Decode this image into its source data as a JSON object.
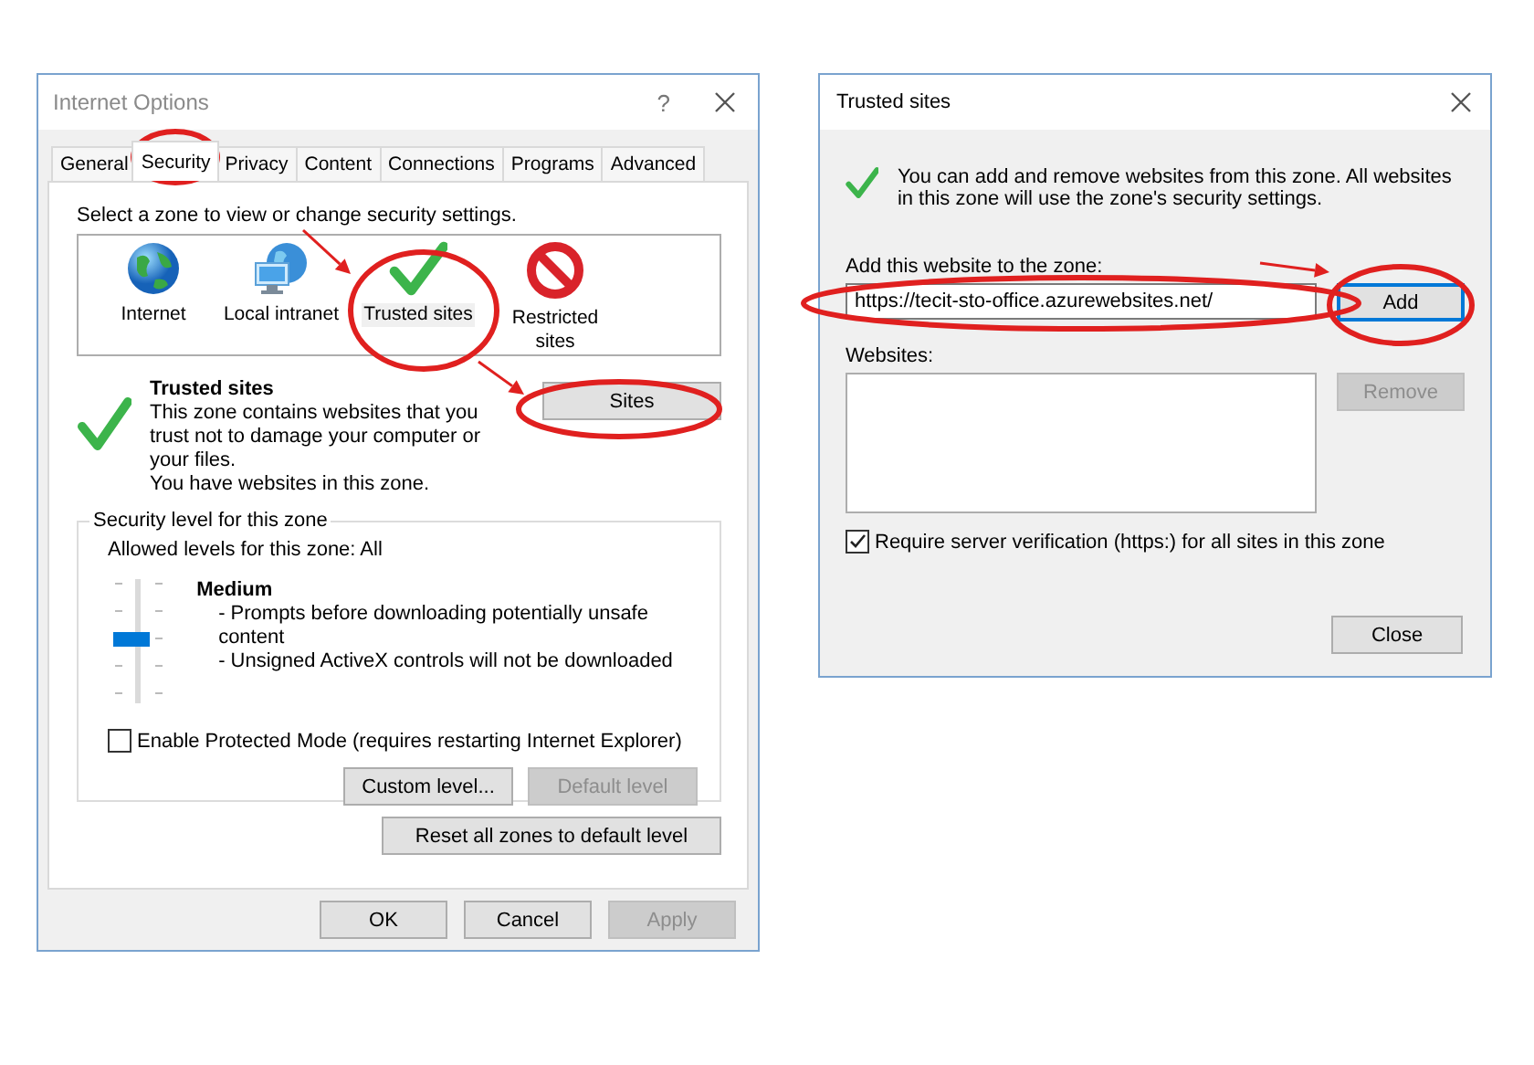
{
  "internet_options": {
    "title": "Internet Options",
    "help": "?",
    "tabs": [
      {
        "label": "General",
        "selected": false
      },
      {
        "label": "Security",
        "selected": true
      },
      {
        "label": "Privacy",
        "selected": false
      },
      {
        "label": "Content",
        "selected": false
      },
      {
        "label": "Connections",
        "selected": false
      },
      {
        "label": "Programs",
        "selected": false
      },
      {
        "label": "Advanced",
        "selected": false
      }
    ],
    "zone_prompt": "Select a zone to view or change security settings.",
    "zones": [
      {
        "label": "Internet",
        "kind": "globe",
        "selected": false
      },
      {
        "label": "Local intranet",
        "kind": "intranet",
        "selected": false
      },
      {
        "label": "Trusted sites",
        "kind": "trusted",
        "selected": true
      },
      {
        "label": "Restricted sites",
        "kind": "restricted",
        "selected": false
      }
    ],
    "zone_info": {
      "title": "Trusted sites",
      "description": "This zone contains websites that you trust not to damage your computer or your files.",
      "note": "You have websites in this zone."
    },
    "sites_button": "Sites",
    "security_level": {
      "legend": "Security level for this zone",
      "allowed": "Allowed levels for this zone: All",
      "level": 0.5,
      "name": "Medium",
      "bullets": [
        "- Prompts before downloading potentially unsafe content",
        "- Unsigned ActiveX controls will not be downloaded"
      ]
    },
    "protected_mode": {
      "label": "Enable Protected Mode (requires restarting Internet Explorer)",
      "checked": false
    },
    "level_buttons": [
      {
        "label": "Custom level...",
        "disabled": false
      },
      {
        "label": "Default level",
        "disabled": true
      }
    ],
    "reset_button": "Reset all zones to default level",
    "footer_buttons": [
      {
        "label": "OK",
        "disabled": false
      },
      {
        "label": "Cancel",
        "disabled": false
      },
      {
        "label": "Apply",
        "disabled": true
      }
    ]
  },
  "trusted_sites": {
    "title": "Trusted sites",
    "info": "You can add and remove websites from this zone. All websites in this zone will use the zone's security settings.",
    "add_label": "Add this website to the zone:",
    "add_value": "https://tecit-sto-office.azurewebsites.net/",
    "add_button": {
      "label": "Add",
      "disabled": false
    },
    "websites_label": "Websites:",
    "remove_button": {
      "label": "Remove",
      "disabled": true
    },
    "require_https": {
      "label": "Require server verification (https:) for all sites in this zone",
      "checked": true
    },
    "close_button": "Close"
  }
}
